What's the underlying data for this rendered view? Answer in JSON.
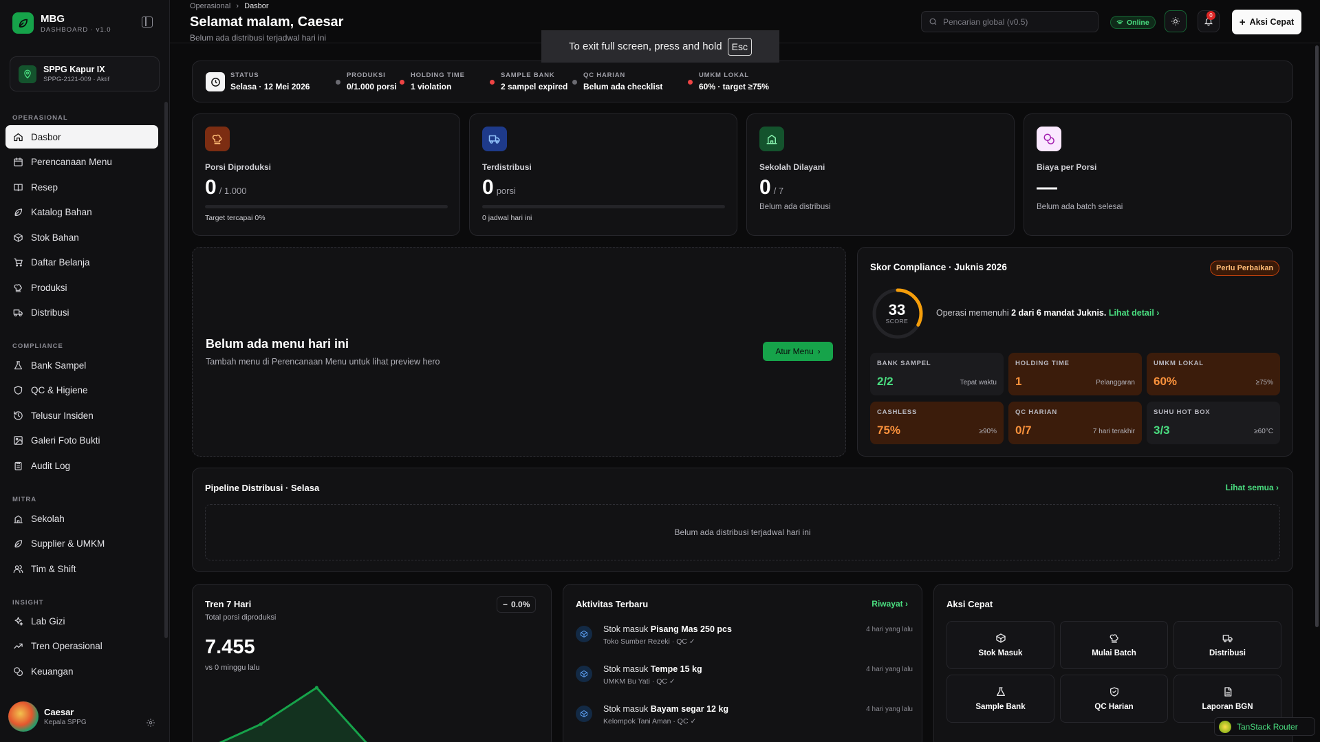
{
  "brand": {
    "title": "MBG",
    "subtitle": "DASHBOARD · v1.0"
  },
  "site": {
    "name": "SPPG Kapur IX",
    "sub": "SPPG-2121-009 · Aktif"
  },
  "sections": {
    "operasional": "OPERASIONAL",
    "compliance": "COMPLIANCE",
    "mitra": "MITRA",
    "insight": "INSIGHT"
  },
  "nav": {
    "operasional": [
      {
        "label": "Dasbor",
        "icon": "home-icon"
      },
      {
        "label": "Perencanaan Menu",
        "icon": "calendar-icon"
      },
      {
        "label": "Resep",
        "icon": "book-icon"
      },
      {
        "label": "Katalog Bahan",
        "icon": "leaf-icon"
      },
      {
        "label": "Stok Bahan",
        "icon": "box-icon"
      },
      {
        "label": "Daftar Belanja",
        "icon": "cart-icon"
      },
      {
        "label": "Produksi",
        "icon": "chef-hat-icon"
      },
      {
        "label": "Distribusi",
        "icon": "truck-icon"
      }
    ],
    "compliance": [
      {
        "label": "Bank Sampel",
        "icon": "flask-icon"
      },
      {
        "label": "QC & Higiene",
        "icon": "shield-icon"
      },
      {
        "label": "Telusur Insiden",
        "icon": "history-icon"
      },
      {
        "label": "Galeri Foto Bukti",
        "icon": "image-icon"
      },
      {
        "label": "Audit Log",
        "icon": "clipboard-icon"
      }
    ],
    "mitra": [
      {
        "label": "Sekolah",
        "icon": "school-icon"
      },
      {
        "label": "Supplier & UMKM",
        "icon": "leaf-icon"
      },
      {
        "label": "Tim & Shift",
        "icon": "users-icon"
      }
    ],
    "insight": [
      {
        "label": "Lab Gizi",
        "icon": "sparkles-icon"
      },
      {
        "label": "Tren Operasional",
        "icon": "trend-icon"
      },
      {
        "label": "Keuangan",
        "icon": "coins-icon"
      }
    ]
  },
  "user": {
    "name": "Caesar",
    "role": "Kepala SPPG"
  },
  "header": {
    "crumb_parent": "Operasional",
    "crumb_current": "Dasbor",
    "greeting": "Selamat malam, Caesar",
    "subtitle": "Belum ada distribusi terjadwal hari ini",
    "search_placeholder": "Pencarian global (v0.5)",
    "online": "Online",
    "notif_count": "0",
    "quick_action": "Aksi Cepat"
  },
  "toast": {
    "text": "To exit full screen, press and hold",
    "key": "Esc"
  },
  "status": [
    {
      "label": "STATUS",
      "value": "Selasa · 12 Mei 2026"
    },
    {
      "label": "PRODUKSI",
      "value": "0/1.000 porsi",
      "color": "#6b6b72"
    },
    {
      "label": "HOLDING TIME",
      "value": "1 violation",
      "color": "#ef4444"
    },
    {
      "label": "SAMPLE BANK",
      "value": "2 sampel expired",
      "color": "#ef4444"
    },
    {
      "label": "QC HARIAN",
      "value": "Belum ada checklist",
      "color": "#6b6b72"
    },
    {
      "label": "UMKM LOKAL",
      "value": "60% · target ≥75%",
      "color": "#ef4444"
    }
  ],
  "kpis": [
    {
      "label": "Porsi Diproduksi",
      "value": "0",
      "unit": "/ 1.000",
      "note": "Target tercapai 0%",
      "progress": 0
    },
    {
      "label": "Terdistribusi",
      "value": "0",
      "unit": "porsi",
      "note": "0 jadwal hari ini",
      "progress": 0
    },
    {
      "label": "Sekolah Dilayani",
      "value": "0",
      "unit": "/ 7",
      "note": "Belum ada distribusi"
    },
    {
      "label": "Biaya per Porsi",
      "value": "—",
      "unit": "",
      "note": "Belum ada batch selesai"
    }
  ],
  "hero": {
    "title": "Belum ada menu hari ini",
    "subtitle": "Tambah menu di Perencanaan Menu untuk lihat preview hero",
    "button": "Atur Menu"
  },
  "compliance": {
    "title": "Skor Compliance · Juknis 2026",
    "badge": "Perlu Perbaikan",
    "score": "33",
    "score_label": "SCORE",
    "score_value": 33,
    "desc_pre": "Operasi memenuhi",
    "desc_bold": "2 dari 6 mandat Juknis.",
    "desc_link": "Lihat detail",
    "tiles": [
      {
        "label": "BANK SAMPEL",
        "value": "2/2",
        "note": "Tepat waktu",
        "color": "#4ade80"
      },
      {
        "label": "HOLDING TIME",
        "value": "1",
        "note": "Pelanggaran",
        "color": "#fb923c"
      },
      {
        "label": "UMKM LOKAL",
        "value": "60%",
        "note": "≥75%",
        "color": "#fb923c"
      },
      {
        "label": "CASHLESS",
        "value": "75%",
        "note": "≥90%",
        "color": "#fb923c"
      },
      {
        "label": "QC HARIAN",
        "value": "0/7",
        "note": "7 hari terakhir",
        "color": "#fb923c"
      },
      {
        "label": "SUHU HOT BOX",
        "value": "3/3",
        "note": "≥60°C",
        "color": "#4ade80"
      }
    ]
  },
  "pipeline": {
    "title": "Pipeline Distribusi · Selasa",
    "link": "Lihat semua",
    "empty": "Belum ada distribusi terjadwal hari ini"
  },
  "trend": {
    "title": "Tren 7 Hari",
    "subtitle": "Total porsi diproduksi",
    "change": "0.0%",
    "value": "7.455",
    "vs": "vs 0 minggu lalu"
  },
  "chart_data": {
    "type": "area",
    "values": [
      0,
      1600,
      3900,
      0,
      0,
      0,
      0
    ],
    "color": "#16a34a"
  },
  "activity": {
    "title": "Aktivitas Terbaru",
    "link": "Riwayat",
    "items": [
      {
        "pre": "Stok masuk",
        "bold": "Pisang Mas 250 pcs",
        "sub": "Toko Sumber Rezeki · QC ✓",
        "time": "4 hari yang lalu"
      },
      {
        "pre": "Stok masuk",
        "bold": "Tempe 15 kg",
        "sub": "UMKM Bu Yati · QC ✓",
        "time": "4 hari yang lalu"
      },
      {
        "pre": "Stok masuk",
        "bold": "Bayam segar 12 kg",
        "sub": "Kelompok Tani Aman · QC ✓",
        "time": "4 hari yang lalu"
      }
    ]
  },
  "quick": {
    "title": "Aksi Cepat",
    "items": [
      {
        "label": "Stok Masuk",
        "icon": "box-icon"
      },
      {
        "label": "Mulai Batch",
        "icon": "chef-hat-icon"
      },
      {
        "label": "Distribusi",
        "icon": "truck-icon"
      },
      {
        "label": "Sample Bank",
        "icon": "flask-icon"
      },
      {
        "label": "QC Harian",
        "icon": "shield-check-icon"
      },
      {
        "label": "Laporan BGN",
        "icon": "file-icon"
      }
    ]
  },
  "devtools": {
    "label": "TanStack Router"
  }
}
